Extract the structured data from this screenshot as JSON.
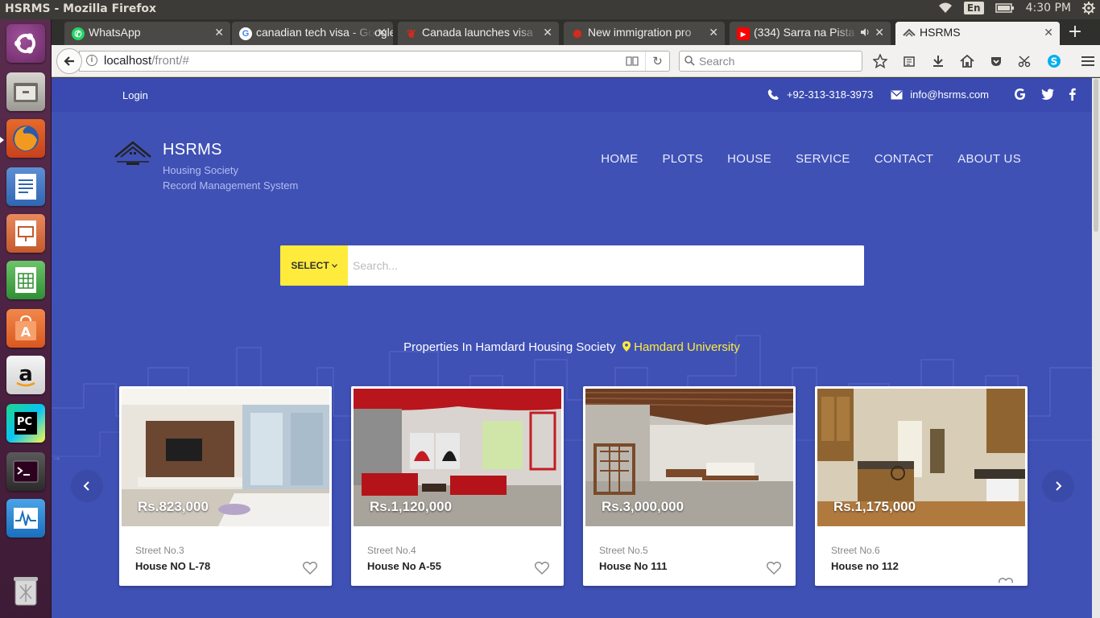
{
  "system": {
    "window_title": "HSRMS - Mozilla Firefox",
    "keyboard_layout": "En",
    "clock": "4:30 PM"
  },
  "launcher": {
    "items": [
      "ubuntu-dash",
      "files",
      "firefox",
      "libreoffice-writer",
      "libreoffice-impress",
      "libreoffice-calc",
      "software-center",
      "amazon",
      "pycharm",
      "terminal",
      "system-monitor",
      "trash"
    ]
  },
  "browser": {
    "tabs": [
      {
        "label": "WhatsApp",
        "icon": "whatsapp-icon",
        "color": "#25d366"
      },
      {
        "label": "canadian tech visa - Google Search",
        "icon": "google-icon",
        "color": "#4285f4"
      },
      {
        "label": "Canada launches visa",
        "icon": "canada-leaf-icon",
        "color": "#d52b1e"
      },
      {
        "label": "New immigration pro",
        "icon": "cbc-icon",
        "color": "#d52b1e"
      },
      {
        "label": "(334) Sarra na Pista",
        "icon": "youtube-icon",
        "color": "#ff0000"
      },
      {
        "label": "HSRMS",
        "icon": "hsrms-icon",
        "color": "#555555"
      }
    ],
    "url_host": "localhost",
    "url_path": "/front/#",
    "search_placeholder": "Search"
  },
  "page": {
    "top": {
      "login": "Login",
      "phone": "+92-313-318-3973",
      "email": "info@hsrms.com"
    },
    "brand": {
      "name": "HSRMS",
      "tagline_1": "Housing Society",
      "tagline_2": "Record Management System"
    },
    "nav": [
      "HOME",
      "PLOTS",
      "HOUSE",
      "SERVICE",
      "CONTACT",
      "ABOUT US"
    ],
    "search": {
      "select_label": "SELECT",
      "placeholder": "Search..."
    },
    "heading": {
      "text": "Properties In Hamdard Housing Society",
      "location": "Hamdard University"
    },
    "properties": [
      {
        "price": "Rs.823,000",
        "street": "Street No.3",
        "name": "House NO L-78"
      },
      {
        "price": "Rs.1,120,000",
        "street": "Street No.4",
        "name": "House No A-55"
      },
      {
        "price": "Rs.3,000,000",
        "street": "Street No.5",
        "name": "House No 111"
      },
      {
        "price": "Rs.1,175,000",
        "street": "Street No.6",
        "name": "House no 112"
      }
    ],
    "colors": {
      "primary": "#3f51b5",
      "accent": "#ffeb3b"
    }
  }
}
